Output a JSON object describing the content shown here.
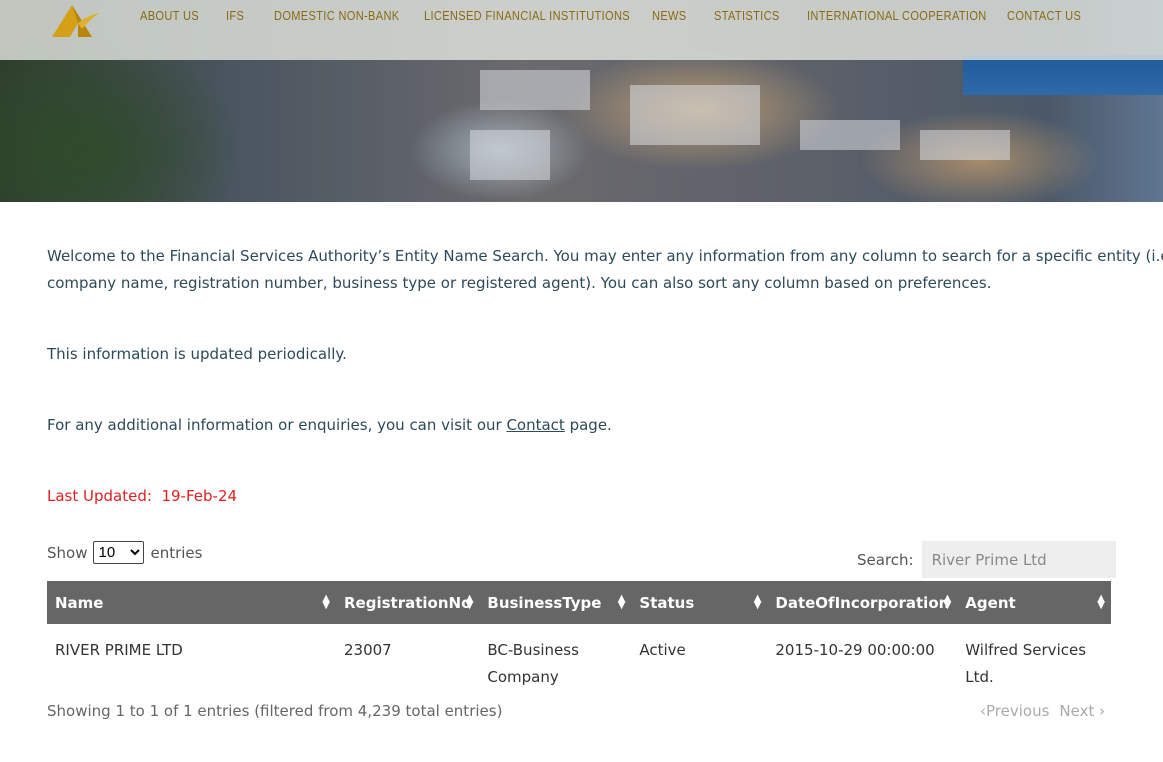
{
  "nav": {
    "items": [
      "ABOUT US",
      "IFS",
      "DOMESTIC NON-BANK",
      "LICENSED FINANCIAL INSTITUTIONS",
      "NEWS",
      "STATISTICS",
      "INTERNATIONAL COOPERATION",
      "CONTACT US"
    ]
  },
  "intro": {
    "p1a": "Welcome to the Financial Services Authority’s Entity Name Search. You may enter any information from any column to search for a specific entity (i.e.",
    "p1b": "company name, registration number, business type or registered agent). You can also sort any column based on preferences.",
    "p2": "This information is updated periodically.",
    "p3_before": "For any additional information or enquiries, you can visit our ",
    "p3_link": "Contact",
    "p3_after": " page.",
    "last_updated_label": "Last Updated:",
    "last_updated_value": "19-Feb-24"
  },
  "length": {
    "show": "Show",
    "value": "10",
    "entries": "entries"
  },
  "search": {
    "label": "Search:",
    "value": "River Prime Ltd"
  },
  "table": {
    "headers": [
      "Name",
      "RegistrationNo",
      "BusinessType",
      "Status",
      "DateOfIncorporation",
      "Agent"
    ],
    "rows": [
      [
        "RIVER PRIME LTD",
        "23007",
        "BC-Business Company",
        "Active",
        "2015-10-29 00:00:00",
        "Wilfred Services Ltd."
      ]
    ]
  },
  "info": "Showing 1 to 1 of 1 entries (filtered from 4,239 total entries)",
  "pagination": {
    "previous": "Previous",
    "next": "Next"
  },
  "colors": {
    "nav": "#8a6a12",
    "header_bg": "#666666",
    "updated": "#e02020",
    "text": "#2c4a5a"
  }
}
